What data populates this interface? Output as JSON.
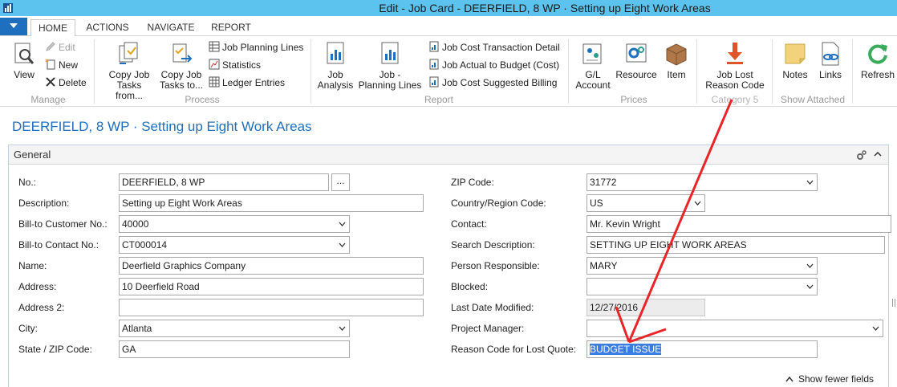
{
  "window": {
    "title": "Edit - Job Card - DEERFIELD, 8 WP · Setting up Eight Work Areas"
  },
  "tabs": [
    {
      "label": "HOME"
    },
    {
      "label": "ACTIONS"
    },
    {
      "label": "NAVIGATE"
    },
    {
      "label": "REPORT"
    }
  ],
  "ribbon": {
    "manage": {
      "label": "Manage",
      "view": "View",
      "edit": "Edit",
      "new": "New",
      "delete": "Delete"
    },
    "process": {
      "label": "Process",
      "copy_from_1": "Copy Job",
      "copy_from_2": "Tasks from...",
      "copy_to_1": "Copy Job",
      "copy_to_2": "Tasks to...",
      "planning_lines": "Job Planning Lines",
      "statistics": "Statistics",
      "ledger_entries": "Ledger Entries"
    },
    "report": {
      "label": "Report",
      "analysis_1": "Job",
      "analysis_2": "Analysis",
      "planning_1": "Job -",
      "planning_2": "Planning Lines",
      "cost_trans": "Job Cost Transaction Detail",
      "actual_budget": "Job Actual to Budget (Cost)",
      "suggested_billing": "Job Cost Suggested Billing"
    },
    "prices": {
      "label": "Prices",
      "gl_1": "G/L",
      "gl_2": "Account",
      "resource": "Resource",
      "item": "Item"
    },
    "category5": {
      "label": "Category 5",
      "lost_1": "Job Lost",
      "lost_2": "Reason Code"
    },
    "attached": {
      "label": "Show Attached",
      "notes": "Notes",
      "links": "Links"
    },
    "refresh": "Refresh"
  },
  "page": {
    "title": "DEERFIELD, 8 WP · Setting up Eight Work Areas"
  },
  "general": {
    "title": "General",
    "ellipsis": "...",
    "show_fewer": "Show fewer fields",
    "left": {
      "no_label": "No.:",
      "no": "DEERFIELD, 8 WP",
      "description_label": "Description:",
      "description": "Setting up Eight Work Areas",
      "bill_to_customer_label": "Bill-to Customer No.:",
      "bill_to_customer": "40000",
      "bill_to_contact_label": "Bill-to Contact No.:",
      "bill_to_contact": "CT000014",
      "name_label": "Name:",
      "name": "Deerfield Graphics Company",
      "address_label": "Address:",
      "address": "10 Deerfield Road",
      "address2_label": "Address 2:",
      "address2": "",
      "city_label": "City:",
      "city": "Atlanta",
      "state_zip_label": "State / ZIP Code:",
      "state": "GA"
    },
    "right": {
      "zip_label": "ZIP Code:",
      "zip": "31772",
      "country_label": "Country/Region Code:",
      "country": "US",
      "contact_label": "Contact:",
      "contact": "Mr. Kevin Wright",
      "search_desc_label": "Search Description:",
      "search_desc": "SETTING UP EIGHT WORK AREAS",
      "person_label": "Person Responsible:",
      "person": "MARY",
      "blocked_label": "Blocked:",
      "blocked": "",
      "last_modified_label": "Last Date Modified:",
      "last_modified": "12/27/2016",
      "project_manager_label": "Project Manager:",
      "project_manager": "",
      "reason_lost_label": "Reason Code for Lost Quote:",
      "reason_lost": "BUDGET ISSUE"
    }
  },
  "colors": {
    "titlebar": "#5bc3ee",
    "accent": "#1f6fbf",
    "annotation_arrow": "#e8262a",
    "selection": "#3a7de0"
  }
}
